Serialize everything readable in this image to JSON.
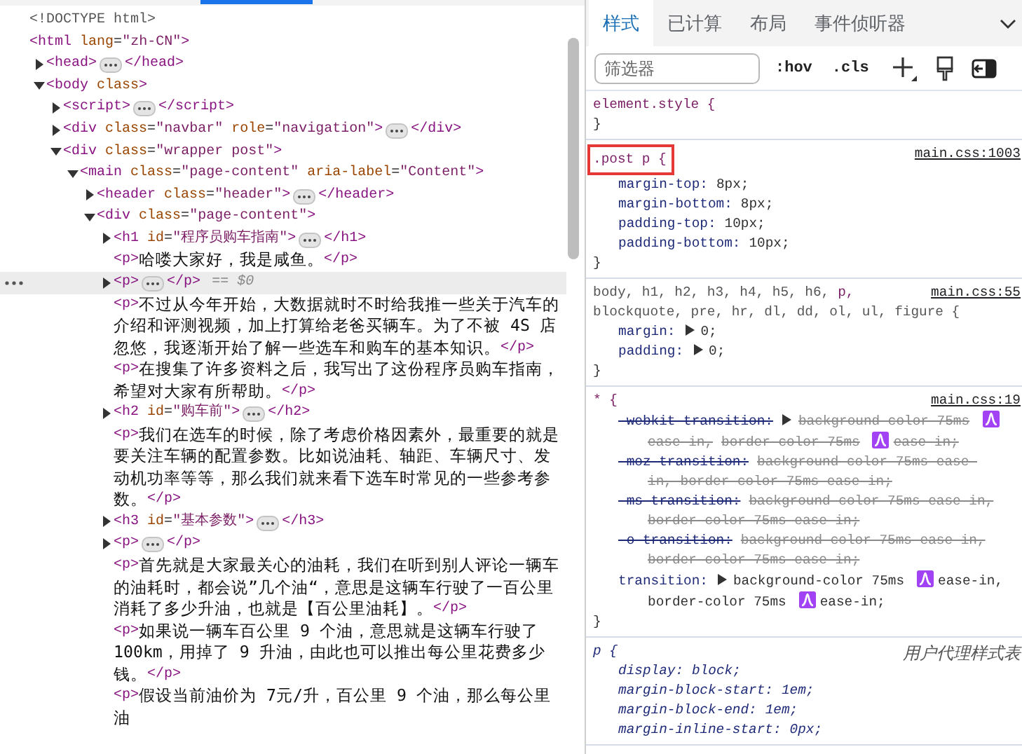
{
  "dom_tree": [
    {
      "kind": "doctype",
      "open": "<!DOCTYPE html>",
      "selected": false
    },
    {
      "kind": "root",
      "open": "<html lang=\"zh-CN\">",
      "selected": false,
      "children": [
        {
          "kind": "element",
          "open": "<head>",
          "close": "</head>",
          "expanded": false,
          "selected": false
        },
        {
          "kind": "element",
          "open": "<body class>",
          "expanded": true,
          "selected": false,
          "children": [
            {
              "kind": "element",
              "open": "<script>",
              "close": "</script>",
              "expanded": false,
              "selected": false
            },
            {
              "kind": "element",
              "open": "<div class=\"navbar\" role=\"navigation\">",
              "close": "</div>",
              "expanded": false,
              "selected": false
            },
            {
              "kind": "element",
              "open": "<div class=\"wrapper post\">",
              "expanded": true,
              "selected": false,
              "children": [
                {
                  "kind": "element",
                  "open": "<main class=\"page-content\" aria-label=\"Content\">",
                  "expanded": true,
                  "selected": false,
                  "children": [
                    {
                      "kind": "element",
                      "open": "<header class=\"header\">",
                      "close": "</header>",
                      "expanded": false,
                      "selected": false
                    },
                    {
                      "kind": "element",
                      "open": "<div class=\"page-content\">",
                      "expanded": true,
                      "selected": false,
                      "children": [
                        {
                          "kind": "element",
                          "open": "<h1 id=\"程序员购车指南\">",
                          "close": "</h1>",
                          "expanded": false,
                          "selected": false
                        },
                        {
                          "kind": "text-element",
                          "open": "<p>",
                          "text": "哈喽大家好，我是咸鱼。",
                          "close": "</p>",
                          "selected": false
                        },
                        {
                          "kind": "element",
                          "open": "<p>",
                          "close": "</p>",
                          "expanded": false,
                          "selected": true,
                          "marker": "== $0"
                        },
                        {
                          "kind": "text-element",
                          "open": "<p>",
                          "text": "不过从今年开始，大数据就时不时给我推一些关于汽车的介绍和评测视频，加上打算给老爸买辆车。为了不被 4S 店忽悠，我逐渐开始了解一些选车和购车的基本知识。",
                          "close": "</p>",
                          "selected": false
                        },
                        {
                          "kind": "text-element",
                          "open": "<p>",
                          "text": "在搜集了许多资料之后，我写出了这份程序员购车指南，希望对大家有所帮助。",
                          "close": "</p>",
                          "selected": false
                        },
                        {
                          "kind": "element",
                          "open": "<h2 id=\"购车前\">",
                          "close": "</h2>",
                          "expanded": false,
                          "selected": false
                        },
                        {
                          "kind": "text-element",
                          "open": "<p>",
                          "text": "我们在选车的时候，除了考虑价格因素外，最重要的就是要关注车辆的配置参数。比如说油耗、轴距、车辆尺寸、发动机功率等等，那么我们就来看下选车时常见的一些参考参数。",
                          "close": "</p>",
                          "selected": false
                        },
                        {
                          "kind": "element",
                          "open": "<h3 id=\"基本参数\">",
                          "close": "</h3>",
                          "expanded": false,
                          "selected": false
                        },
                        {
                          "kind": "element",
                          "open": "<p>",
                          "close": "</p>",
                          "expanded": false,
                          "selected": false
                        },
                        {
                          "kind": "text-element",
                          "open": "<p>",
                          "text": "首先就是大家最关心的油耗，我们在听到别人评论一辆车的油耗时，都会说”几个油“，意思是这辆车行驶了一百公里消耗了多少升油，也就是【百公里油耗】。",
                          "close": "</p>",
                          "selected": false
                        },
                        {
                          "kind": "text-element",
                          "open": "<p>",
                          "text": "如果说一辆车百公里 9 个油，意思就是这辆车行驶了 100km，用掉了 9 升油，由此也可以推出每公里花费多少钱。",
                          "close": "</p>",
                          "selected": false
                        },
                        {
                          "kind": "text-element",
                          "open": "<p>",
                          "text": "假设当前油价为 7元/升，百公里 9 个油，那么每公里油",
                          "selected": false
                        }
                      ]
                    }
                  ]
                }
              ]
            }
          ]
        }
      ]
    }
  ],
  "styles_panel": {
    "tabs": [
      {
        "label": "样式",
        "selected": true
      },
      {
        "label": "已计算",
        "selected": false
      },
      {
        "label": "布局",
        "selected": false
      },
      {
        "label": "事件侦听器",
        "selected": false
      }
    ],
    "filter": {
      "placeholder": "筛选器"
    },
    "toolbar_buttons": [
      ":hov",
      ".cls"
    ],
    "rules": [
      {
        "kind": "author",
        "highlighted": false,
        "selector": [
          {
            "text": "element.style {",
            "matched": true
          }
        ],
        "close": "}"
      },
      {
        "kind": "author",
        "highlighted": true,
        "selector": [
          {
            "text": ".post p {",
            "matched": true
          }
        ],
        "source": "main.css:1003",
        "properties": [
          {
            "name": "margin-top:",
            "overridden": false,
            "value": [
              {
                "kind": "text",
                "text": "8px;"
              }
            ]
          },
          {
            "name": "margin-bottom:",
            "overridden": false,
            "value": [
              {
                "kind": "text",
                "text": "8px;"
              }
            ]
          },
          {
            "name": "padding-top:",
            "overridden": false,
            "value": [
              {
                "kind": "text",
                "text": "10px;"
              }
            ]
          },
          {
            "name": "padding-bottom:",
            "overridden": false,
            "value": [
              {
                "kind": "text",
                "text": "10px;"
              }
            ]
          }
        ],
        "close": "}"
      },
      {
        "kind": "author",
        "highlighted": false,
        "selector": [
          {
            "text": "body, h1, h2, h3, h4, h5, h6,",
            "matched": false
          },
          {
            "text": "p,",
            "matched": true
          },
          {
            "text": "blockquote, pre, hr, dl, dd, ol, ul, figure {",
            "matched": false
          }
        ],
        "source": "main.css:55",
        "properties": [
          {
            "name": "margin:",
            "overridden": false,
            "value": [
              {
                "kind": "expander"
              },
              {
                "kind": "text",
                "text": "0;"
              }
            ]
          },
          {
            "name": "padding:",
            "overridden": false,
            "value": [
              {
                "kind": "expander"
              },
              {
                "kind": "text",
                "text": "0;"
              }
            ]
          }
        ],
        "close": "}"
      },
      {
        "kind": "author",
        "highlighted": false,
        "selector": [
          {
            "text": "* {",
            "matched": true
          }
        ],
        "source": "main.css:19",
        "properties": [
          {
            "name": "-webkit-transition:",
            "overridden": true,
            "value": [
              {
                "kind": "expander"
              },
              {
                "kind": "text",
                "text": "background-color 75ms"
              },
              {
                "kind": "easing"
              },
              {
                "kind": "text",
                "text": "ease-in,"
              },
              {
                "kind": "text",
                "text": "border-color 75ms"
              },
              {
                "kind": "easing"
              },
              {
                "kind": "text",
                "text": "ease-in;"
              }
            ]
          },
          {
            "name": "-moz-transition:",
            "overridden": true,
            "value": [
              {
                "kind": "text",
                "text": "background-color 75ms ease-"
              },
              {
                "kind": "text",
                "text": "in, border-color 75ms ease-in;"
              }
            ]
          },
          {
            "name": "-ms-transition:",
            "overridden": true,
            "value": [
              {
                "kind": "text",
                "text": "background-color 75ms ease-in,"
              },
              {
                "kind": "text",
                "text": "border-color 75ms ease-in;"
              }
            ]
          },
          {
            "name": "-o-transition:",
            "overridden": true,
            "value": [
              {
                "kind": "text",
                "text": "background-color 75ms ease-in,"
              },
              {
                "kind": "text",
                "text": "border-color 75ms ease-in;"
              }
            ]
          },
          {
            "name": "transition:",
            "overridden": false,
            "value": [
              {
                "kind": "expander"
              },
              {
                "kind": "text",
                "text": "background-color 75ms"
              },
              {
                "kind": "easing"
              },
              {
                "kind": "text",
                "text": "ease-in,"
              },
              {
                "kind": "text",
                "text": "border-color 75ms"
              },
              {
                "kind": "easing"
              },
              {
                "kind": "text",
                "text": "ease-in;"
              }
            ]
          }
        ],
        "close": "}"
      },
      {
        "kind": "user-agent",
        "highlighted": false,
        "selector": [
          {
            "text": "p {",
            "matched": true
          }
        ],
        "source": "用户代理样式表",
        "properties": [
          {
            "name": "display:",
            "overridden": false,
            "value": [
              {
                "kind": "text",
                "text": "block;"
              }
            ]
          },
          {
            "name": "margin-block-start:",
            "overridden": false,
            "value": [
              {
                "kind": "text",
                "text": "1em;"
              }
            ]
          },
          {
            "name": "margin-block-end:",
            "overridden": false,
            "value": [
              {
                "kind": "text",
                "text": "1em;"
              }
            ]
          },
          {
            "name": "margin-inline-start:",
            "overridden": false,
            "value": [
              {
                "kind": "text",
                "text": "0px;"
              }
            ]
          }
        ]
      }
    ]
  }
}
